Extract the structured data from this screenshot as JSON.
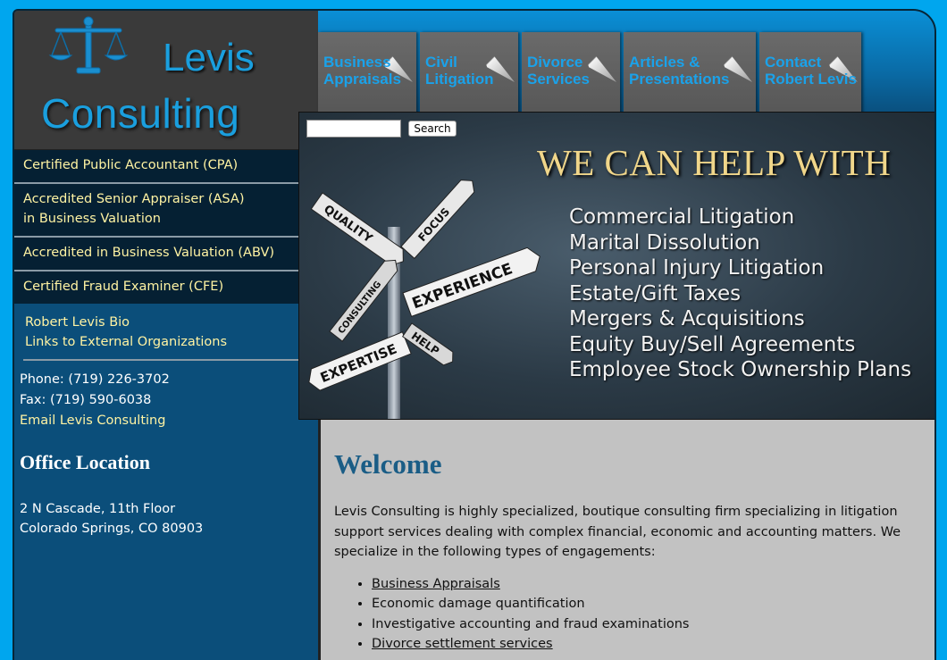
{
  "logo": {
    "line1": "Levis",
    "line2": "Consulting"
  },
  "nav": {
    "tabs": [
      {
        "line1": "Business",
        "line2": "Appraisals"
      },
      {
        "line1": "Civil",
        "line2": "Litigation"
      },
      {
        "line1": "Divorce",
        "line2": "Services"
      },
      {
        "line1": "Articles &",
        "line2": "Presentations"
      },
      {
        "line1": "Contact",
        "line2": "Robert Levis"
      }
    ]
  },
  "search": {
    "button_label": "Search",
    "value": ""
  },
  "sidebar": {
    "credentials": [
      {
        "line1": "Certified Public Accountant (CPA)",
        "line2": ""
      },
      {
        "line1": "Accredited Senior Appraiser (ASA)",
        "line2": "in Business Valuation"
      },
      {
        "line1": "Accredited in Business Valuation (ABV)",
        "line2": ""
      },
      {
        "line1": "Certified Fraud Examiner (CFE)",
        "line2": ""
      }
    ],
    "links": [
      "Robert Levis Bio",
      "Links to External Organizations"
    ],
    "phone": "Phone: (719) 226-3702",
    "fax": "Fax: (719) 590-6038",
    "email_label": "Email Levis Consulting",
    "office_title": "Office Location",
    "address_line1": "2 N Cascade, 11th Floor",
    "address_line2": "Colorado Springs, CO 80903"
  },
  "banner": {
    "headline": "WE CAN HELP WITH",
    "services": [
      "Commercial Litigation",
      "Marital Dissolution",
      "Personal Injury Litigation",
      "Estate/Gift Taxes",
      "Mergers & Acquisitions",
      "Equity Buy/Sell Agreements",
      "Employee Stock Ownership Plans"
    ],
    "signs": [
      "QUALITY",
      "FOCUS",
      "EXPERIENCE",
      "CONSULTING",
      "EXPERTISE",
      "HELP"
    ]
  },
  "main": {
    "heading": "Welcome",
    "intro": "Levis Consulting is highly specialized, boutique consulting firm specializing in litigation support services dealing with complex financial, economic and accounting matters. We specialize in the following types of engagements:",
    "engagements": [
      {
        "label": "Business Appraisals",
        "link": true
      },
      {
        "label": "Economic damage quantification",
        "link": false
      },
      {
        "label": "Investigative accounting and fraud examinations",
        "link": false
      },
      {
        "label": "Divorce settlement services",
        "link": true
      }
    ]
  },
  "colors": {
    "accent": "#00a6ee",
    "gold": "#fff3a3",
    "brand_blue": "#1a9fde"
  }
}
